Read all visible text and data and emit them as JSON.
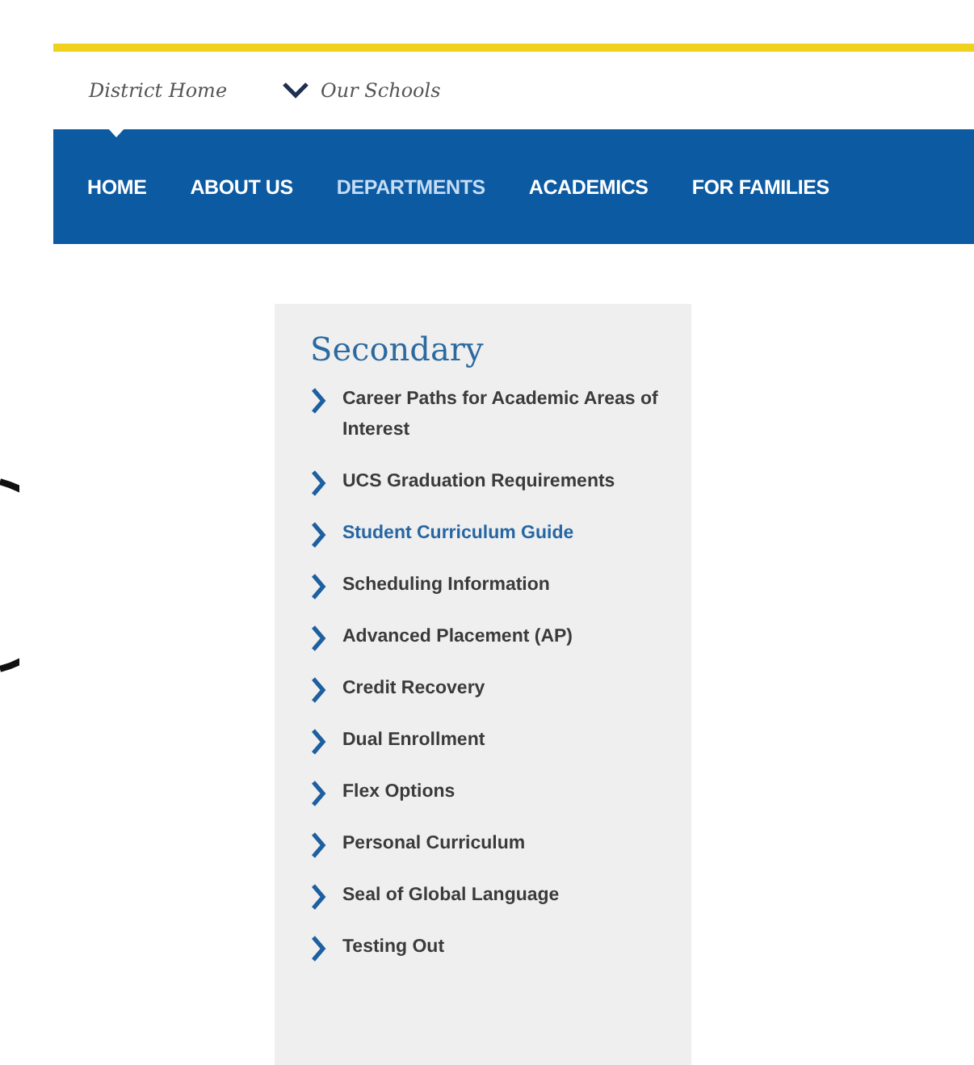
{
  "top_links": [
    {
      "label": "District Home",
      "has_caret": false
    },
    {
      "label": "Our Schools",
      "has_caret": true
    }
  ],
  "nav": [
    {
      "label": "HOME",
      "selected": true,
      "highlighted": false
    },
    {
      "label": "ABOUT US",
      "selected": false,
      "highlighted": false
    },
    {
      "label": "DEPARTMENTS",
      "selected": false,
      "highlighted": true
    },
    {
      "label": "ACADEMICS",
      "selected": false,
      "highlighted": false
    },
    {
      "label": "FOR FAMILIES",
      "selected": false,
      "highlighted": false
    }
  ],
  "sidebar": {
    "title": "Secondary",
    "items": [
      {
        "label": "Career Paths for Academic Areas of Interest",
        "selected": false
      },
      {
        "label": "UCS Graduation Requirements",
        "selected": false
      },
      {
        "label": "Student Curriculum Guide",
        "selected": true
      },
      {
        "label": "Scheduling Information",
        "selected": false
      },
      {
        "label": "Advanced Placement (AP)",
        "selected": false
      },
      {
        "label": "Credit Recovery",
        "selected": false
      },
      {
        "label": "Dual Enrollment",
        "selected": false
      },
      {
        "label": "Flex Options",
        "selected": false
      },
      {
        "label": "Personal Curriculum",
        "selected": false
      },
      {
        "label": "Seal of Global Language",
        "selected": false
      },
      {
        "label": "Testing Out",
        "selected": false
      }
    ]
  }
}
